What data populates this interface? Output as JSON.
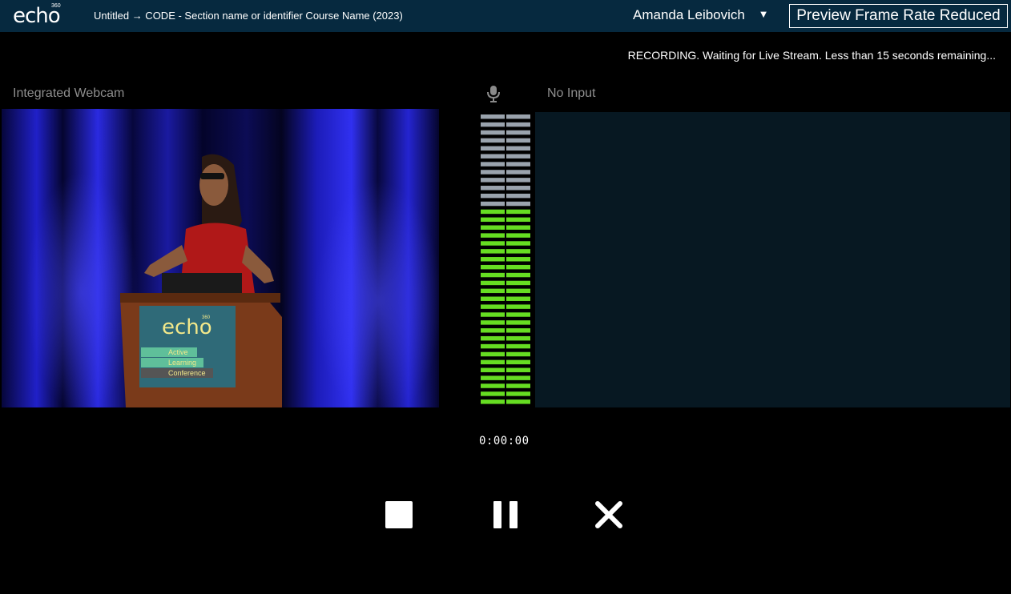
{
  "header": {
    "logo_text": "echo",
    "logo_superscript": "360",
    "breadcrumb": "Untitled → CODE - Section name or identifier Course Name (2023)",
    "user_name": "Amanda Leibovich",
    "caret": "▼",
    "preview_label": "Preview Frame Rate Reduced",
    "background_color": "#06293f"
  },
  "status_text": "RECORDING. Waiting for Live Stream. Less than 15 seconds remaining...",
  "sources": {
    "video_label": "Integrated Webcam",
    "secondary_label": "No Input"
  },
  "podium_sign": {
    "logo_text": "echo",
    "logo_superscript": "360",
    "lines": [
      "Active",
      "Learning",
      "Conference"
    ]
  },
  "audio_meter": {
    "total_segments": 37,
    "lit_fraction": 0.68,
    "lit_color": "#66dd22",
    "unlit_color": "#9aa3ad"
  },
  "timer": "0:00:00",
  "controls": {
    "stop_icon": "stop-icon",
    "pause_icon": "pause-icon",
    "cancel_icon": "close-icon"
  }
}
